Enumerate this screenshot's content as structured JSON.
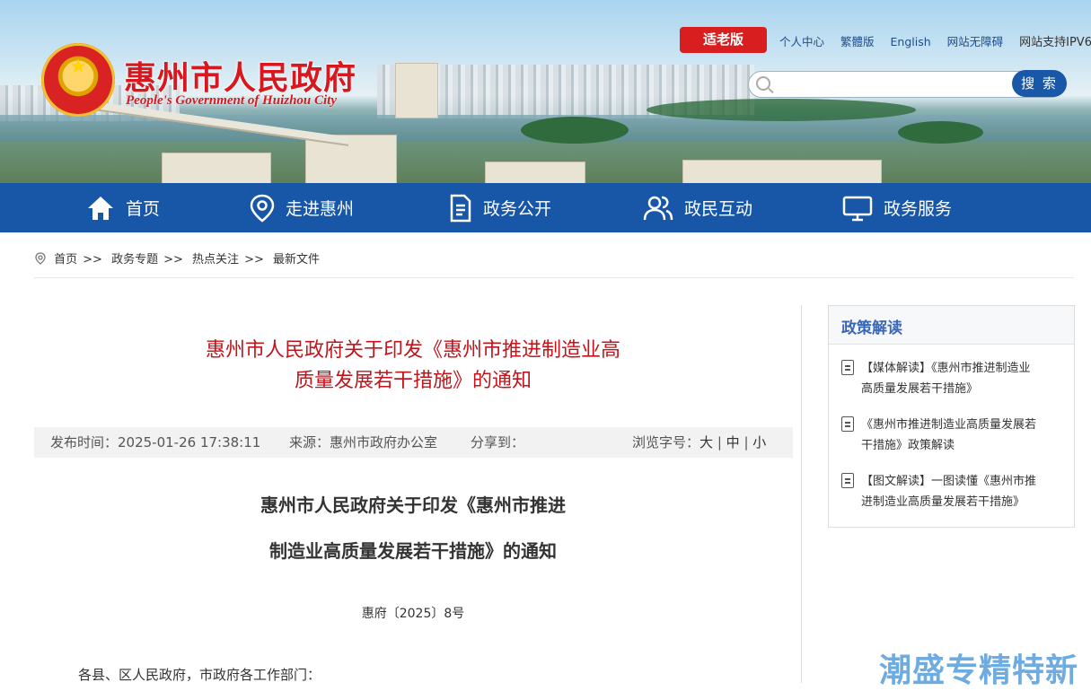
{
  "header": {
    "site_title": "惠州市人民政府",
    "site_subtitle": "People's Government of Huizhou City",
    "elder_mode_label": "适老版",
    "top_links": [
      "个人中心",
      "繁體版",
      "English",
      "网站无障碍"
    ],
    "ipv6_text": "网站支持IPV6",
    "search_placeholder": "",
    "search_button": "搜 索"
  },
  "nav": [
    {
      "label": "首页",
      "icon": "home-icon"
    },
    {
      "label": "走进惠州",
      "icon": "location-pin-icon"
    },
    {
      "label": "政务公开",
      "icon": "document-icon"
    },
    {
      "label": "政民互动",
      "icon": "users-icon"
    },
    {
      "label": "政务服务",
      "icon": "monitor-icon"
    }
  ],
  "breadcrumb": {
    "icon": "location-icon",
    "items": [
      "首页",
      "政务专题",
      "热点关注",
      "最新文件"
    ],
    "separator": ">>"
  },
  "article": {
    "title_line1": "惠州市人民政府关于印发《惠州市推进制造业高",
    "title_line2": "质量发展若干措施》的通知",
    "meta": {
      "publish_time": "发布时间：2025-01-26 17:38:11",
      "source": "来源：惠州市政府办公室",
      "share": "分享到：",
      "font_size_label": "浏览字号：",
      "sizes": [
        "大",
        "中",
        "小"
      ]
    },
    "doc_title_line1": "惠州市人民政府关于印发《惠州市推进",
    "doc_title_line2": "制造业高质量发展若干措施》的通知",
    "doc_number": "惠府〔2025〕8号",
    "salutation": "各县、区人民政府，市政府各工作部门："
  },
  "sidebar": {
    "title": "政策解读",
    "items": [
      {
        "line1": "【媒体解读】《惠州市推进制造业",
        "line2": "高质量发展若干措施》"
      },
      {
        "line1": "《惠州市推进制造业高质量发展若",
        "line2": "干措施》政策解读"
      },
      {
        "line1": "【图文解读】一图读懂《惠州市推",
        "line2": "进制造业高质量发展若干措施》"
      }
    ]
  },
  "watermark": "潮盛专精特新",
  "colors": {
    "nav_blue": "#1856a8",
    "title_red": "#c3141b",
    "elder_red": "#d81e1e",
    "side_title_blue": "#3a66b7"
  }
}
